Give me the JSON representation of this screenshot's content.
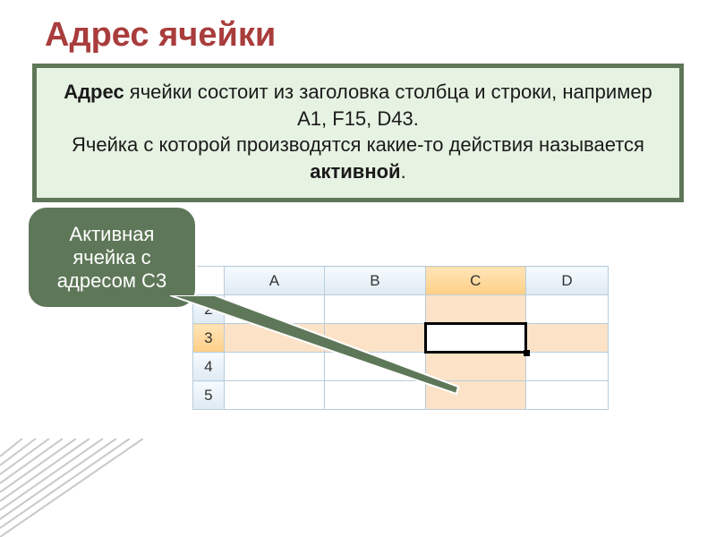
{
  "title": "Адрес ячейки",
  "info": {
    "bold_word": "Адрес",
    "line1_rest": " ячейки состоит из заголовка столбца и строки, например А1, F15, D43.",
    "line2_pre": "Ячейка с которой производятся какие-то действия называется ",
    "line2_bold": "активной",
    "line2_post": "."
  },
  "callout": {
    "line1": "Активная",
    "line2": "ячейка с",
    "line3": "адресом С3"
  },
  "sheet": {
    "columns": [
      "A",
      "B",
      "C",
      "D"
    ],
    "rows": [
      "2",
      "3",
      "4",
      "5"
    ],
    "highlighted_column_index": 2,
    "highlighted_row_index": 1,
    "active_cell": "C3"
  }
}
